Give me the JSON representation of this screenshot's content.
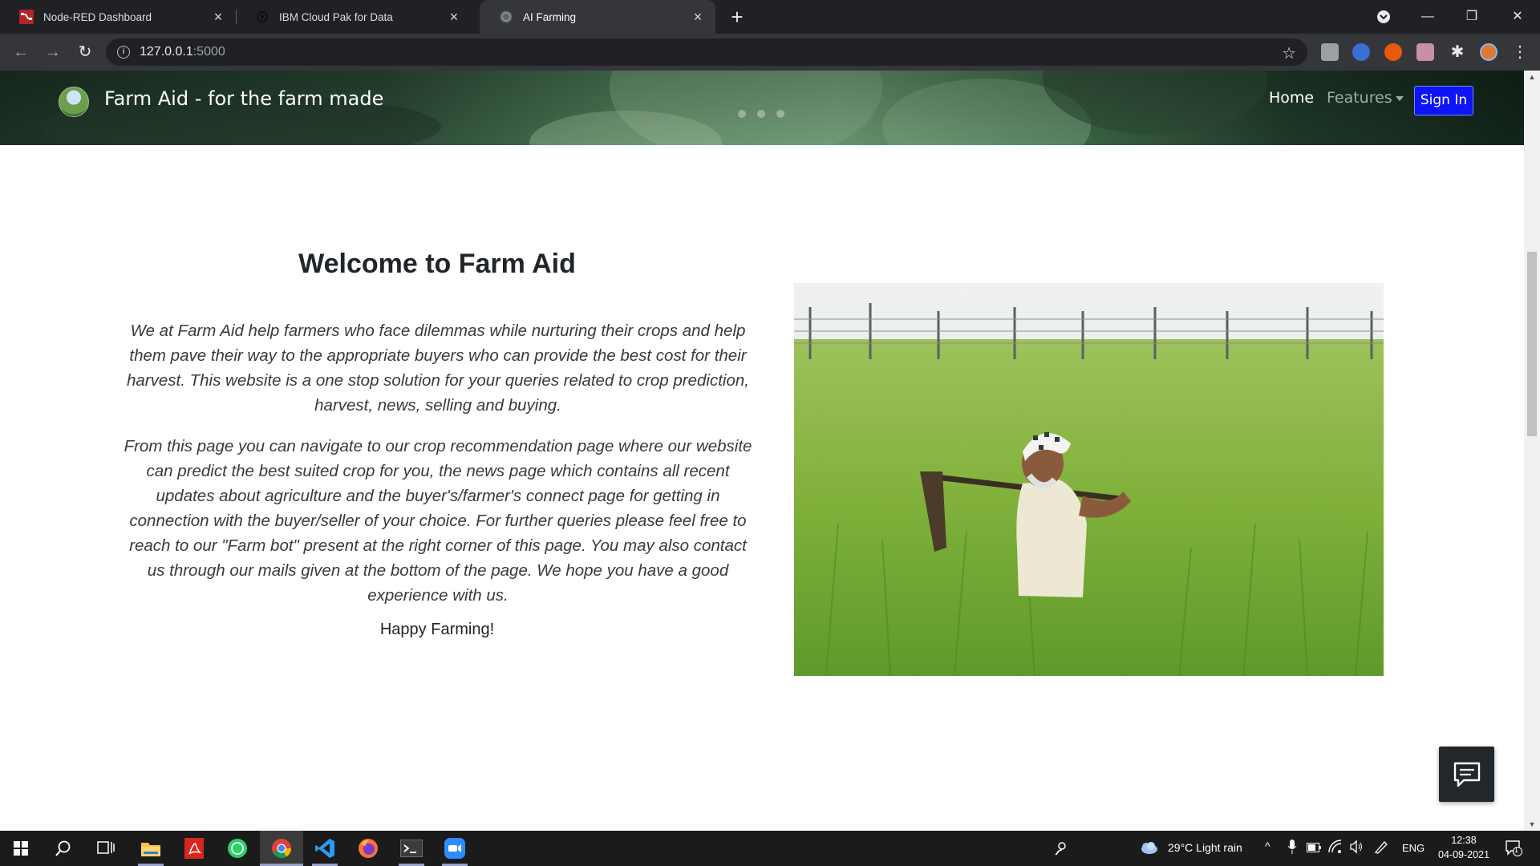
{
  "browser": {
    "tabs": [
      {
        "title": "Node-RED Dashboard",
        "favicon": "node-red-icon",
        "active": false
      },
      {
        "title": "IBM Cloud Pak for Data",
        "favicon": "ibm-cloud-icon",
        "active": false
      },
      {
        "title": "AI Farming",
        "favicon": "globe-icon",
        "active": true
      }
    ],
    "url_host": "127.0.0.1",
    "url_port": ":5000"
  },
  "navbar": {
    "brand": "Farm Aid - for the farm made",
    "home": "Home",
    "features": "Features",
    "signin": "Sign In"
  },
  "main": {
    "heading": "Welcome to Farm Aid",
    "paragraph1": "We at Farm Aid help farmers who face dilemmas while nurturing their crops and help them pave their way to the appropriate buyers who can provide the best cost for their harvest. This website is a one stop solution for your queries related to crop prediction, harvest, news, selling and buying.",
    "paragraph2": "From this page you can navigate to our crop recommendation page where our website can predict the best suited crop for you, the news page which contains all recent updates about agriculture and the buyer's/farmer's connect page for getting in connection with the buyer/seller of your choice. For further queries please feel free to reach to our \"Farm bot\" present at the right corner of this page. You may also contact us through our mails given at the bottom of the page. We hope you have a good experience with us.",
    "closing": "Happy Farming!"
  },
  "taskbar": {
    "weather": "29°C  Light rain",
    "language": "ENG",
    "time": "12:38",
    "date": "04-09-2021",
    "notifications": "1"
  },
  "colors": {
    "signin_bg": "#0d14f5",
    "chat_bg": "#22272b",
    "tab_active_bg": "#35363a",
    "tabstrip_bg": "#202124"
  }
}
